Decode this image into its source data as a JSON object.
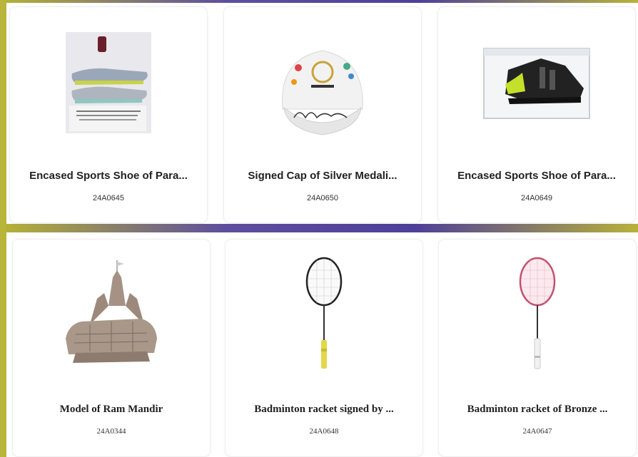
{
  "colors": {
    "accent_olive": "#b6b336",
    "accent_purple": "#4e3f9a",
    "card_bg": "#ffffff"
  },
  "items": [
    {
      "title": "Encased Sports Shoe of Para...",
      "code": "24A0645",
      "icon": "sports-shoes-in-frame"
    },
    {
      "title": "Signed Cap of Silver Medali...",
      "code": "24A0650",
      "icon": "signed-cap"
    },
    {
      "title": "Encased Sports Shoe of Para...",
      "code": "24A0649",
      "icon": "shoe-in-display-case"
    },
    {
      "title": "Model of Ram Mandir",
      "code": "24A0344",
      "icon": "temple-model"
    },
    {
      "title": "Badminton racket signed by ...",
      "code": "24A0648",
      "icon": "badminton-racket-black"
    },
    {
      "title": "Badminton racket of Bronze ...",
      "code": "24A0647",
      "icon": "badminton-racket-pink"
    }
  ]
}
